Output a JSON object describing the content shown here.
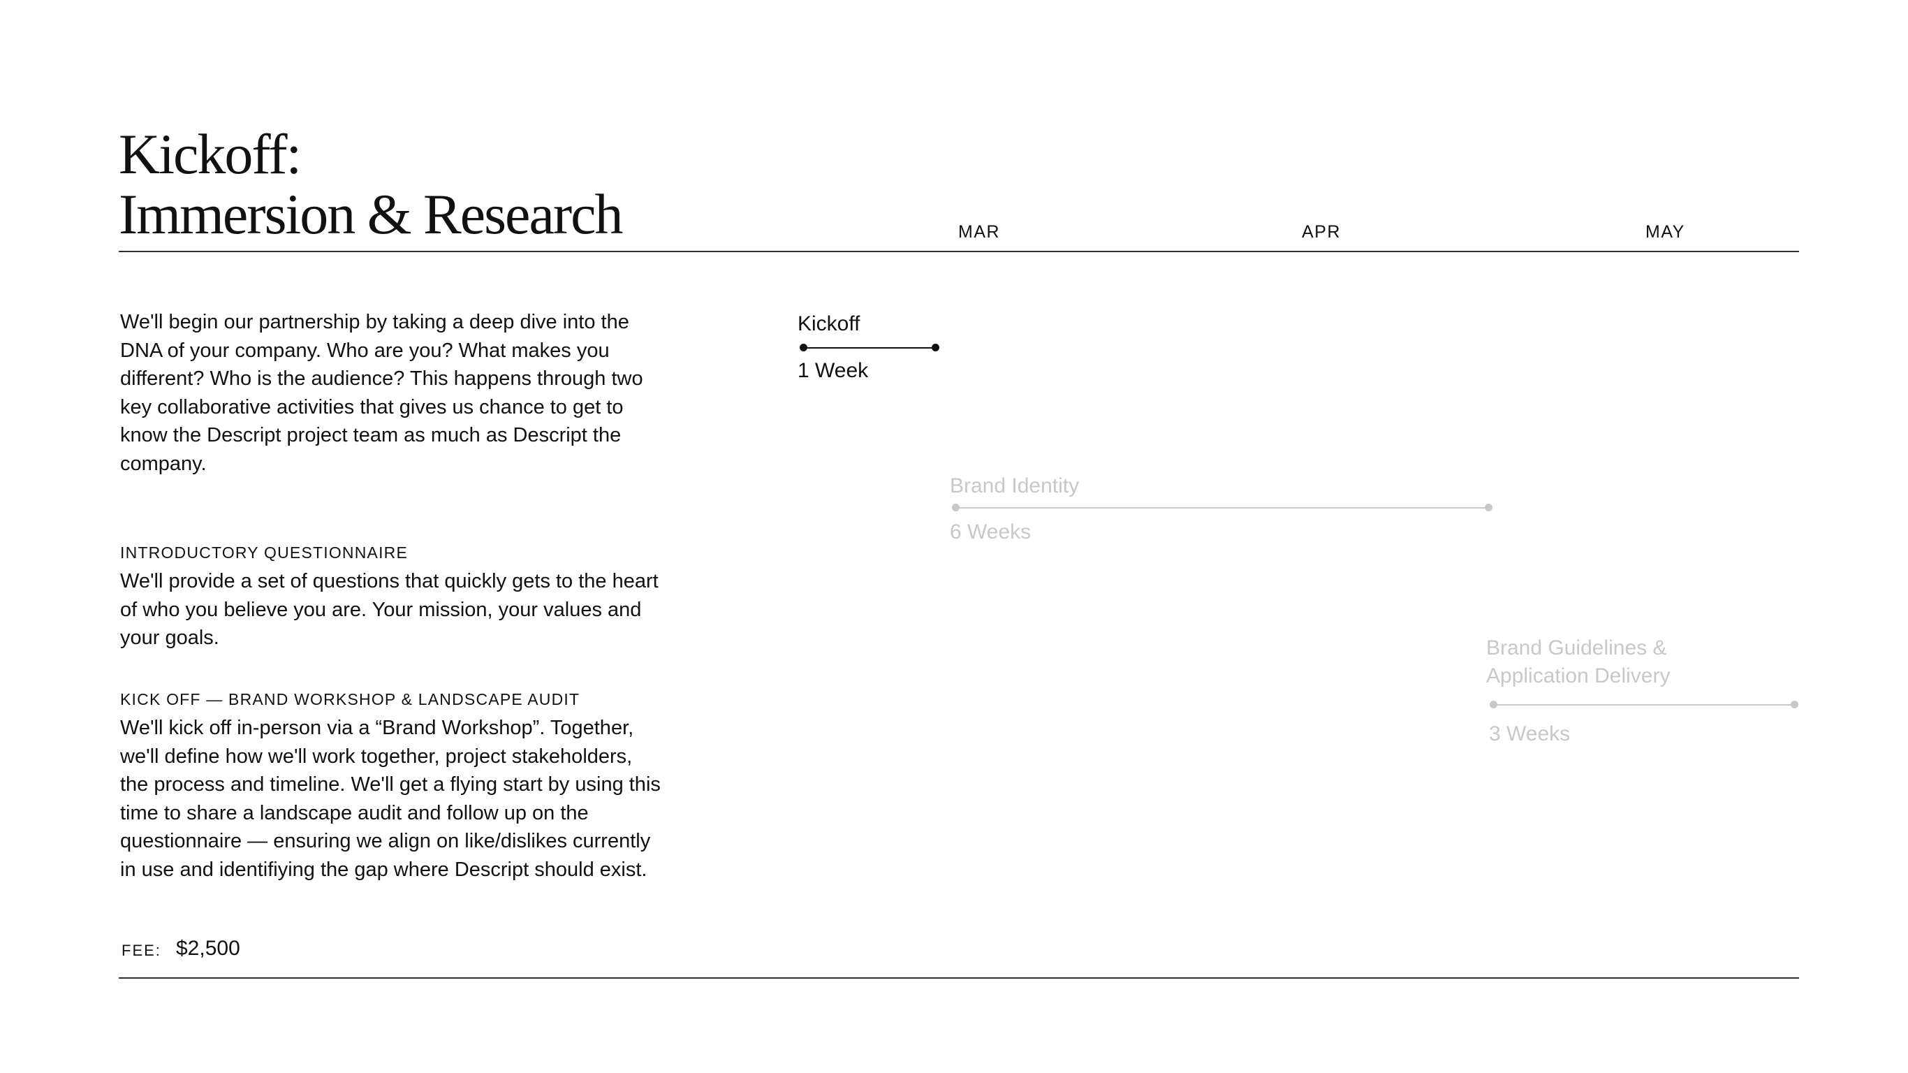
{
  "header": {
    "title_line1": "Kickoff:",
    "title_line2": "Immersion & Research"
  },
  "timeline": {
    "months": [
      "MAR",
      "APR",
      "MAY"
    ],
    "phases": [
      {
        "label": "Kickoff",
        "duration": "1 Week",
        "status": "active",
        "color": "#111111"
      },
      {
        "label": "Brand Identity",
        "duration": "6 Weeks",
        "status": "upcoming",
        "color": "#c8c8c8"
      },
      {
        "label": "Brand Guidelines & Application Delivery",
        "label_line1": "Brand Guidelines &",
        "label_line2": "Application Delivery",
        "duration": "3 Weeks",
        "status": "upcoming",
        "color": "#c8c8c8"
      }
    ]
  },
  "content": {
    "intro": "We'll  begin our partnership by taking a deep dive into the DNA of your company. Who are you? What makes you different? Who is the audience? This happens through two key collaborative activities that gives us chance to get to know the Descript project team as much as Descript the company.",
    "sections": [
      {
        "heading": "INTRODUCTORY QUESTIONNAIRE",
        "body": "We'll provide a set of questions that quickly gets to the heart of who you believe you are. Your mission, your values and your goals."
      },
      {
        "heading": "KICK OFF — BRAND WORKSHOP & LANDSCAPE AUDIT",
        "body": "We'll kick off in-person via a “Brand Workshop”. Together, we'll define how we'll work together, project stakeholders, the process and timeline. We'll get a flying start by using this time to share a landscape audit and follow up on the questionnaire — ensuring we align on like/dislikes currently in use and identifiying the gap where Descript should exist."
      }
    ],
    "fee_label": "FEE:",
    "fee_value": "$2,500"
  }
}
